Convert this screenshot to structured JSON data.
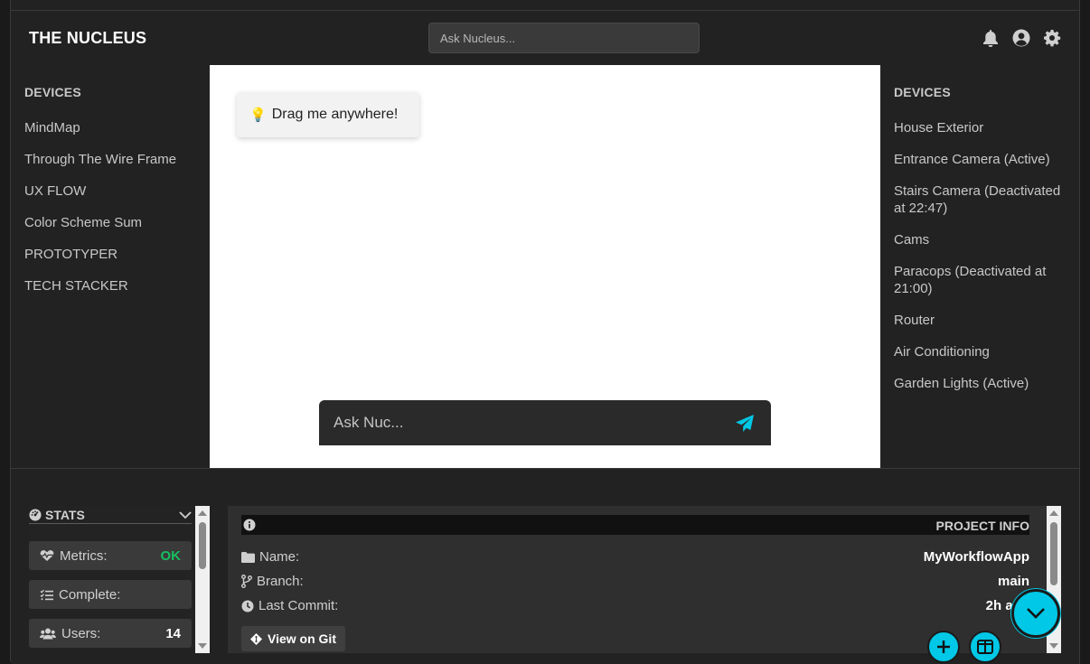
{
  "header": {
    "brand": "THE NUCLEUS",
    "search_placeholder": "Ask Nucleus..."
  },
  "left_sidebar": {
    "title": "DEVICES",
    "items": [
      "MindMap",
      "Through The Wire Frame",
      "UX FLOW",
      "Color Scheme Sum",
      "PROTOTYPER",
      "TECH STACKER"
    ]
  },
  "right_sidebar": {
    "title": "DEVICES",
    "items": [
      "House Exterior",
      "Entrance Camera (Active)",
      "Stairs Camera (Deactivated at 22:47)",
      "Cams",
      "Paracops (Deactivated at 21:00)",
      "Router",
      "Air Conditioning",
      "Garden Lights (Active)"
    ]
  },
  "canvas": {
    "drag_card_text": "Drag me anywhere!",
    "chat_placeholder": "Ask Nuc..."
  },
  "stats": {
    "title": "STATS",
    "metrics_label": "Metrics:",
    "metrics_value": "OK",
    "complete_label": "Complete:",
    "complete_value": "",
    "users_label": "Users:",
    "users_value": "14"
  },
  "project": {
    "title": "PROJECT INFO",
    "name_label": "Name:",
    "name_value": "MyWorkflowApp",
    "branch_label": "Branch:",
    "branch_value": "main",
    "commit_label": "Last Commit:",
    "commit_value": "2h ago",
    "git_button": "View on Git"
  },
  "colors": {
    "accent": "#00c8e6",
    "ok": "#16c060",
    "background": "#222222"
  }
}
